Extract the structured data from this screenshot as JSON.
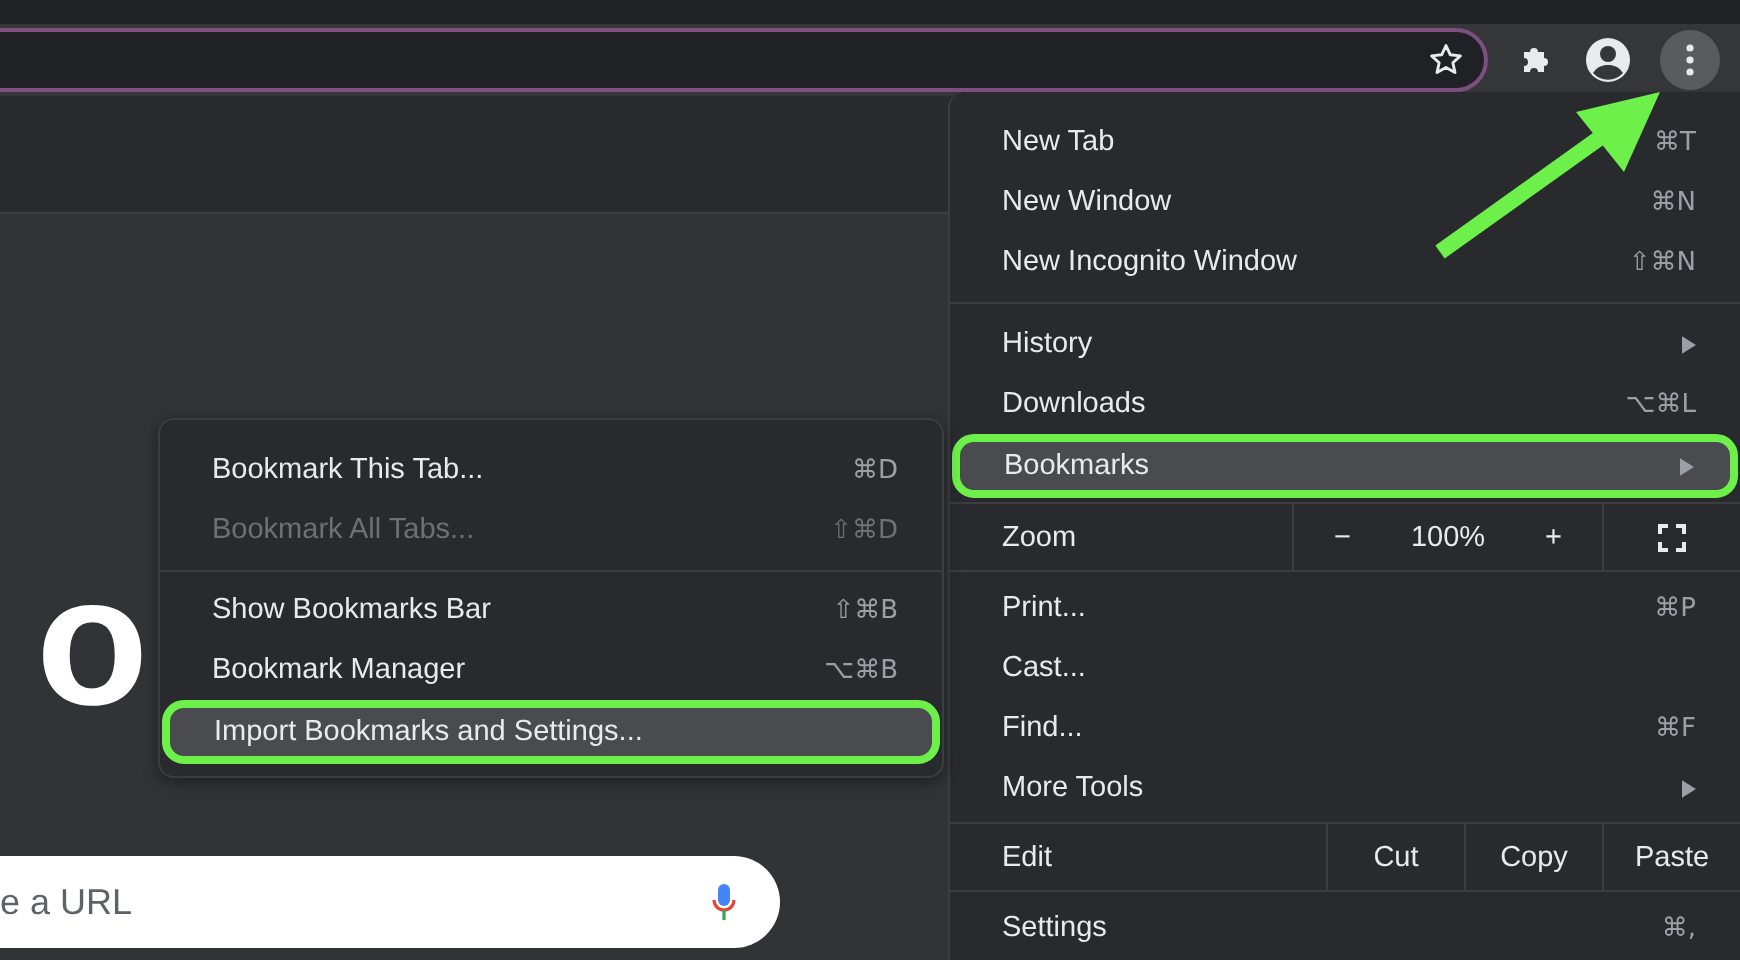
{
  "page": {
    "logo_text": "o",
    "search": {
      "placeholder": "e a URL"
    }
  },
  "menu": {
    "items": [
      {
        "kind": "item",
        "label": "New Tab",
        "shortcut": "⌘T",
        "submenu": false,
        "selected": false
      },
      {
        "kind": "item",
        "label": "New Window",
        "shortcut": "⌘N",
        "submenu": false,
        "selected": false
      },
      {
        "kind": "item",
        "label": "New Incognito Window",
        "shortcut": "⇧⌘N",
        "submenu": false,
        "selected": false
      },
      {
        "kind": "separator"
      },
      {
        "kind": "item",
        "label": "History",
        "submenu": true,
        "selected": false
      },
      {
        "kind": "item",
        "label": "Downloads",
        "shortcut": "⌥⌘L",
        "submenu": false,
        "selected": false
      },
      {
        "kind": "item",
        "label": "Bookmarks",
        "submenu": true,
        "selected": true
      },
      {
        "kind": "zoom",
        "label": "Zoom",
        "zoom_out": "−",
        "value": "100%",
        "zoom_in": "+"
      },
      {
        "kind": "item",
        "label": "Print...",
        "shortcut": "⌘P",
        "submenu": false,
        "selected": false
      },
      {
        "kind": "item",
        "label": "Cast...",
        "submenu": false,
        "selected": false
      },
      {
        "kind": "item",
        "label": "Find...",
        "shortcut": "⌘F",
        "submenu": false,
        "selected": false
      },
      {
        "kind": "item",
        "label": "More Tools",
        "submenu": true,
        "selected": false
      },
      {
        "kind": "edit",
        "label": "Edit",
        "buttons": [
          "Cut",
          "Copy",
          "Paste"
        ]
      },
      {
        "kind": "item",
        "label": "Settings",
        "shortcut": "⌘,",
        "submenu": false,
        "selected": false
      }
    ]
  },
  "submenu": {
    "items": [
      {
        "kind": "item",
        "label": "Bookmark This Tab...",
        "shortcut": "⌘D",
        "disabled": false,
        "selected": false
      },
      {
        "kind": "item",
        "label": "Bookmark All Tabs...",
        "shortcut": "⇧⌘D",
        "disabled": true,
        "selected": false
      },
      {
        "kind": "separator"
      },
      {
        "kind": "item",
        "label": "Show Bookmarks Bar",
        "shortcut": "⇧⌘B",
        "disabled": false,
        "selected": false
      },
      {
        "kind": "item",
        "label": "Bookmark Manager",
        "shortcut": "⌥⌘B",
        "disabled": false,
        "selected": false
      },
      {
        "kind": "item",
        "label": "Import Bookmarks and Settings...",
        "disabled": false,
        "selected": true
      }
    ]
  }
}
